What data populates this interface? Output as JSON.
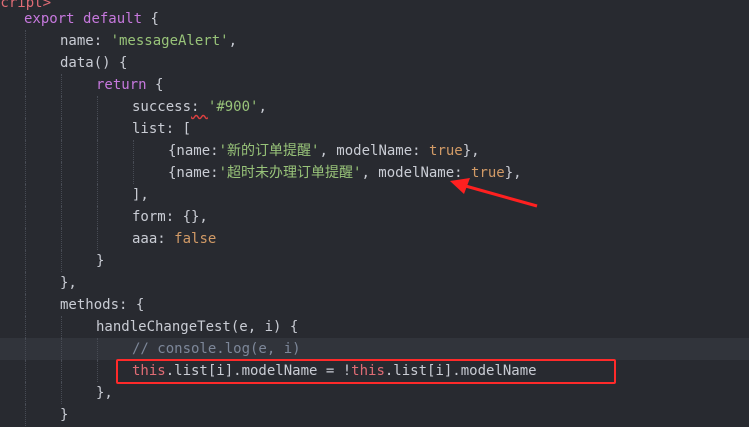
{
  "code_lines": [
    {
      "segments": [
        {
          "t": "script>",
          "c": "this"
        }
      ]
    },
    {
      "segments": [
        {
          "t": "export",
          "c": "kw"
        },
        {
          "t": " ",
          "c": "punct"
        },
        {
          "t": "default",
          "c": "kw"
        },
        {
          "t": " {",
          "c": "punct"
        }
      ]
    },
    {
      "segments": [
        {
          "t": "name",
          "c": "prop"
        },
        {
          "t": ": ",
          "c": "punct"
        },
        {
          "t": "'messageAlert'",
          "c": "str"
        },
        {
          "t": ",",
          "c": "punct"
        }
      ]
    },
    {
      "segments": [
        {
          "t": "data",
          "c": "fn"
        },
        {
          "t": "() {",
          "c": "punct"
        }
      ]
    },
    {
      "segments": [
        {
          "t": "return",
          "c": "kw"
        },
        {
          "t": " {",
          "c": "punct"
        }
      ]
    },
    {
      "segments": [
        {
          "t": "success",
          "c": "prop"
        },
        {
          "t": ": ",
          "c": "punct"
        },
        {
          "t": "'",
          "c": "str"
        },
        {
          "t": "#900",
          "c": "str"
        },
        {
          "t": "'",
          "c": "str"
        },
        {
          "t": ",",
          "c": "punct"
        }
      ]
    },
    {
      "segments": [
        {
          "t": "list",
          "c": "prop"
        },
        {
          "t": ": [",
          "c": "punct"
        }
      ]
    },
    {
      "segments": [
        {
          "t": "{name:",
          "c": "punct"
        },
        {
          "t": "'新的订单提醒'",
          "c": "str"
        },
        {
          "t": ", modelName: ",
          "c": "punct"
        },
        {
          "t": "true",
          "c": "lit"
        },
        {
          "t": "},",
          "c": "punct"
        }
      ]
    },
    {
      "segments": [
        {
          "t": "{name:",
          "c": "punct"
        },
        {
          "t": "'超时未办理订单提醒'",
          "c": "str"
        },
        {
          "t": ", modelName: ",
          "c": "punct"
        },
        {
          "t": "true",
          "c": "lit"
        },
        {
          "t": "},",
          "c": "punct"
        }
      ]
    },
    {
      "segments": [
        {
          "t": "],",
          "c": "punct"
        }
      ]
    },
    {
      "segments": [
        {
          "t": "form",
          "c": "prop"
        },
        {
          "t": ": {},",
          "c": "punct"
        }
      ]
    },
    {
      "segments": [
        {
          "t": "aaa",
          "c": "prop"
        },
        {
          "t": ": ",
          "c": "punct"
        },
        {
          "t": "false",
          "c": "lit"
        }
      ]
    },
    {
      "segments": [
        {
          "t": "}",
          "c": "punct"
        }
      ]
    },
    {
      "segments": [
        {
          "t": "},",
          "c": "punct"
        }
      ]
    },
    {
      "segments": [
        {
          "t": "methods",
          "c": "prop"
        },
        {
          "t": ": {",
          "c": "punct"
        }
      ]
    },
    {
      "segments": [
        {
          "t": "handleChangeTest",
          "c": "fn"
        },
        {
          "t": "(e, i) {",
          "c": "punct"
        }
      ]
    },
    {
      "segments": [
        {
          "t": "// console.log(e, i)",
          "c": "cmt"
        }
      ]
    },
    {
      "segments": [
        {
          "t": "this",
          "c": "this"
        },
        {
          "t": ".list[i].modelName = !",
          "c": "punct"
        },
        {
          "t": "this",
          "c": "this"
        },
        {
          "t": ".list[i].modelName",
          "c": "punct"
        }
      ]
    },
    {
      "segments": [
        {
          "t": "},",
          "c": "punct"
        }
      ]
    },
    {
      "segments": [
        {
          "t": "}",
          "c": "punct"
        }
      ]
    }
  ],
  "colors": {
    "highlight_box": "#ff2a2a",
    "arrow": "#ff2020",
    "error_underline": "#e04040"
  }
}
